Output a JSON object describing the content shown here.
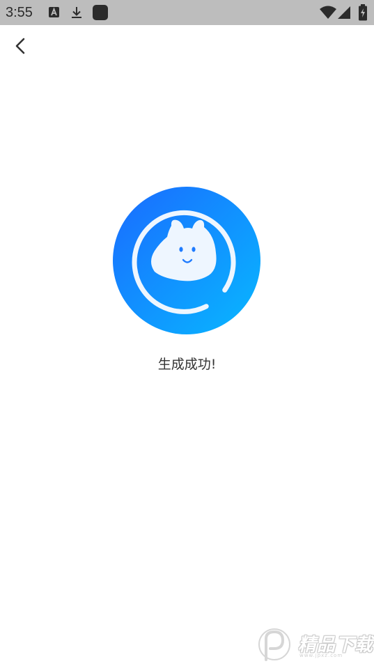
{
  "status_bar": {
    "time": "3:55",
    "icons": [
      "font-a-icon",
      "download-icon",
      "app-square-icon",
      "wifi-icon",
      "signal-icon",
      "battery-charging-icon"
    ],
    "background": "#bdbdbd"
  },
  "nav": {
    "back_icon": "chevron-left-icon"
  },
  "result": {
    "message": "生成成功!",
    "gradient_start": "#1a6bff",
    "gradient_end": "#08b8ff"
  },
  "watermark": {
    "text": "精品下载",
    "url": "www.jpxz.com"
  }
}
